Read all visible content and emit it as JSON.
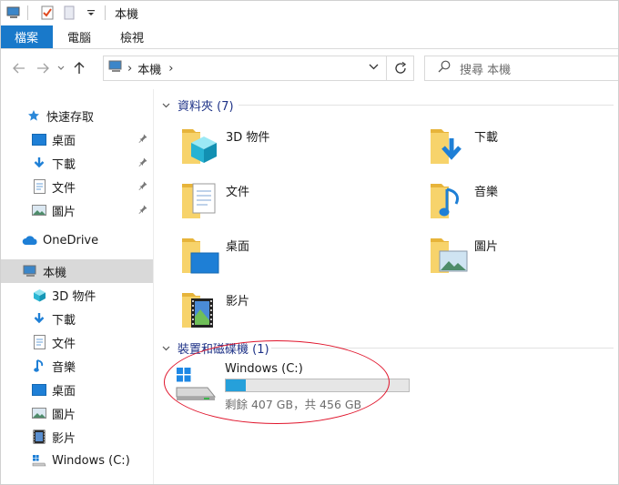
{
  "window": {
    "title": "本機"
  },
  "ribbon": {
    "tabs": [
      "檔案",
      "電腦",
      "檢視"
    ]
  },
  "address": {
    "crumb": "本機",
    "placeholder": "搜尋 本機"
  },
  "sidebar": {
    "items": [
      {
        "label": "快速存取",
        "icon": "star-icon"
      },
      {
        "label": "桌面",
        "icon": "desktop-icon",
        "pinned": true
      },
      {
        "label": "下載",
        "icon": "download-icon",
        "pinned": true
      },
      {
        "label": "文件",
        "icon": "document-icon",
        "pinned": true
      },
      {
        "label": "圖片",
        "icon": "picture-icon",
        "pinned": true
      },
      {
        "label": "OneDrive",
        "icon": "cloud-icon"
      },
      {
        "label": "本機",
        "icon": "computer-icon",
        "selected": true
      },
      {
        "label": "3D 物件",
        "icon": "cube-icon"
      },
      {
        "label": "下載",
        "icon": "download-icon"
      },
      {
        "label": "文件",
        "icon": "document-icon"
      },
      {
        "label": "音樂",
        "icon": "music-icon"
      },
      {
        "label": "桌面",
        "icon": "desktop-icon"
      },
      {
        "label": "圖片",
        "icon": "picture-icon"
      },
      {
        "label": "影片",
        "icon": "video-icon"
      },
      {
        "label": "Windows (C:)",
        "icon": "drive-icon"
      }
    ]
  },
  "folders_group": {
    "heading": "資料夾 (7)",
    "items": [
      {
        "label": "3D 物件",
        "icon": "folder-3d-icon"
      },
      {
        "label": "下載",
        "icon": "folder-download-icon"
      },
      {
        "label": "文件",
        "icon": "folder-document-icon"
      },
      {
        "label": "音樂",
        "icon": "folder-music-icon"
      },
      {
        "label": "桌面",
        "icon": "folder-desktop-icon"
      },
      {
        "label": "圖片",
        "icon": "folder-picture-icon"
      },
      {
        "label": "影片",
        "icon": "folder-video-icon"
      }
    ]
  },
  "drives_group": {
    "heading": "裝置和磁碟機 (1)",
    "drive": {
      "name": "Windows (C:)",
      "free_text": "剩餘 407 GB，共 456 GB",
      "used_fraction": 0.107
    }
  },
  "colors": {
    "accent": "#1979ca",
    "drive_fill": "#26a0da",
    "annotation": "#e0142b",
    "folder": "#f4c542"
  }
}
